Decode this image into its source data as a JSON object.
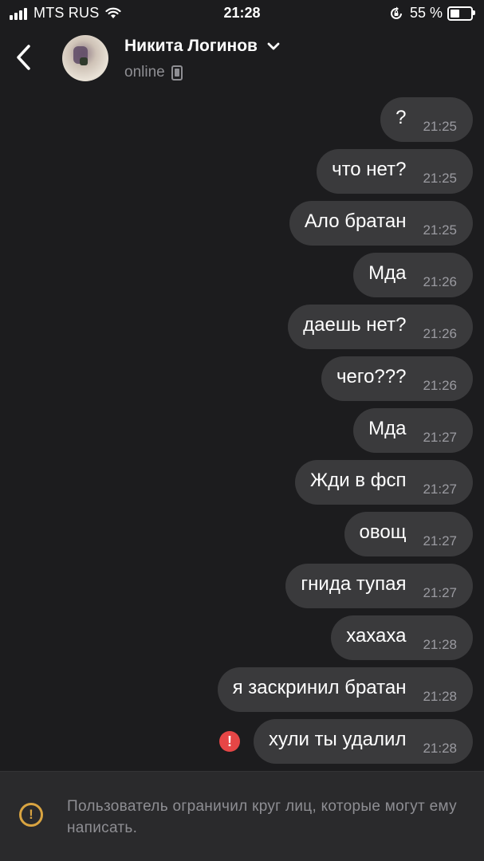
{
  "status_bar": {
    "carrier": "MTS RUS",
    "time": "21:28",
    "battery_percent": "55 %",
    "battery_level": 0.55
  },
  "header": {
    "contact_name": "Никита Логинов",
    "status": "online"
  },
  "messages": [
    {
      "text": "?",
      "time": "21:25"
    },
    {
      "text": "что нет?",
      "time": "21:25"
    },
    {
      "text": "Ало братан",
      "time": "21:25"
    },
    {
      "text": "Мда",
      "time": "21:26"
    },
    {
      "text": "даешь нет?",
      "time": "21:26"
    },
    {
      "text": "чего???",
      "time": "21:26"
    },
    {
      "text": "Мда",
      "time": "21:27"
    },
    {
      "text": "Жди в фсп",
      "time": "21:27"
    },
    {
      "text": "овощ",
      "time": "21:27"
    },
    {
      "text": "гнида тупая",
      "time": "21:27"
    },
    {
      "text": "хахаха",
      "time": "21:28"
    },
    {
      "text": "я заскринил братан",
      "time": "21:28"
    },
    {
      "text": "хули ты удалил",
      "time": "21:28"
    }
  ],
  "footer": {
    "notice": "Пользователь ограничил круг лиц, которые могут ему написать."
  },
  "colors": {
    "background": "#1c1c1e",
    "bubble": "#3a3a3c",
    "error": "#e64646",
    "warning": "#d9a441"
  },
  "icons": {
    "back": "chevron-left-icon",
    "name_dropdown": "chevron-down-icon",
    "device": "phone-icon",
    "error": "exclamation-circle-icon",
    "warning": "warning-circle-icon"
  }
}
